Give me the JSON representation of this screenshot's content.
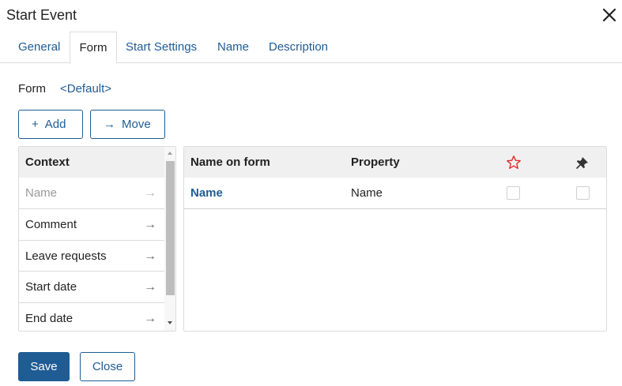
{
  "dialog": {
    "title": "Start Event"
  },
  "tabs": [
    {
      "label": "General"
    },
    {
      "label": "Form"
    },
    {
      "label": "Start Settings"
    },
    {
      "label": "Name"
    },
    {
      "label": "Description"
    }
  ],
  "active_tab": "Form",
  "form": {
    "label": "Form",
    "value": "<Default>"
  },
  "toolbar": {
    "add_label": "Add",
    "add_icon": "+",
    "move_label": "Move",
    "move_icon": "→"
  },
  "context": {
    "header": "Context",
    "items": [
      {
        "label": "Name",
        "disabled": true
      },
      {
        "label": "Comment"
      },
      {
        "label": "Leave requests"
      },
      {
        "label": "Start date"
      },
      {
        "label": "End date"
      }
    ],
    "arrow_icon": "→"
  },
  "fields_grid": {
    "columns": [
      "Name on form",
      "Property",
      "star-icon",
      "pin-icon"
    ],
    "rows": [
      {
        "name_on_form": "Name",
        "property": "Name",
        "required": false,
        "pinned": false
      }
    ]
  },
  "footer": {
    "save_label": "Save",
    "cancel_label": "Close"
  },
  "colors": {
    "accent": "#1f5c94",
    "star": "#e02b2b",
    "header_bg": "#f0f0f0"
  }
}
